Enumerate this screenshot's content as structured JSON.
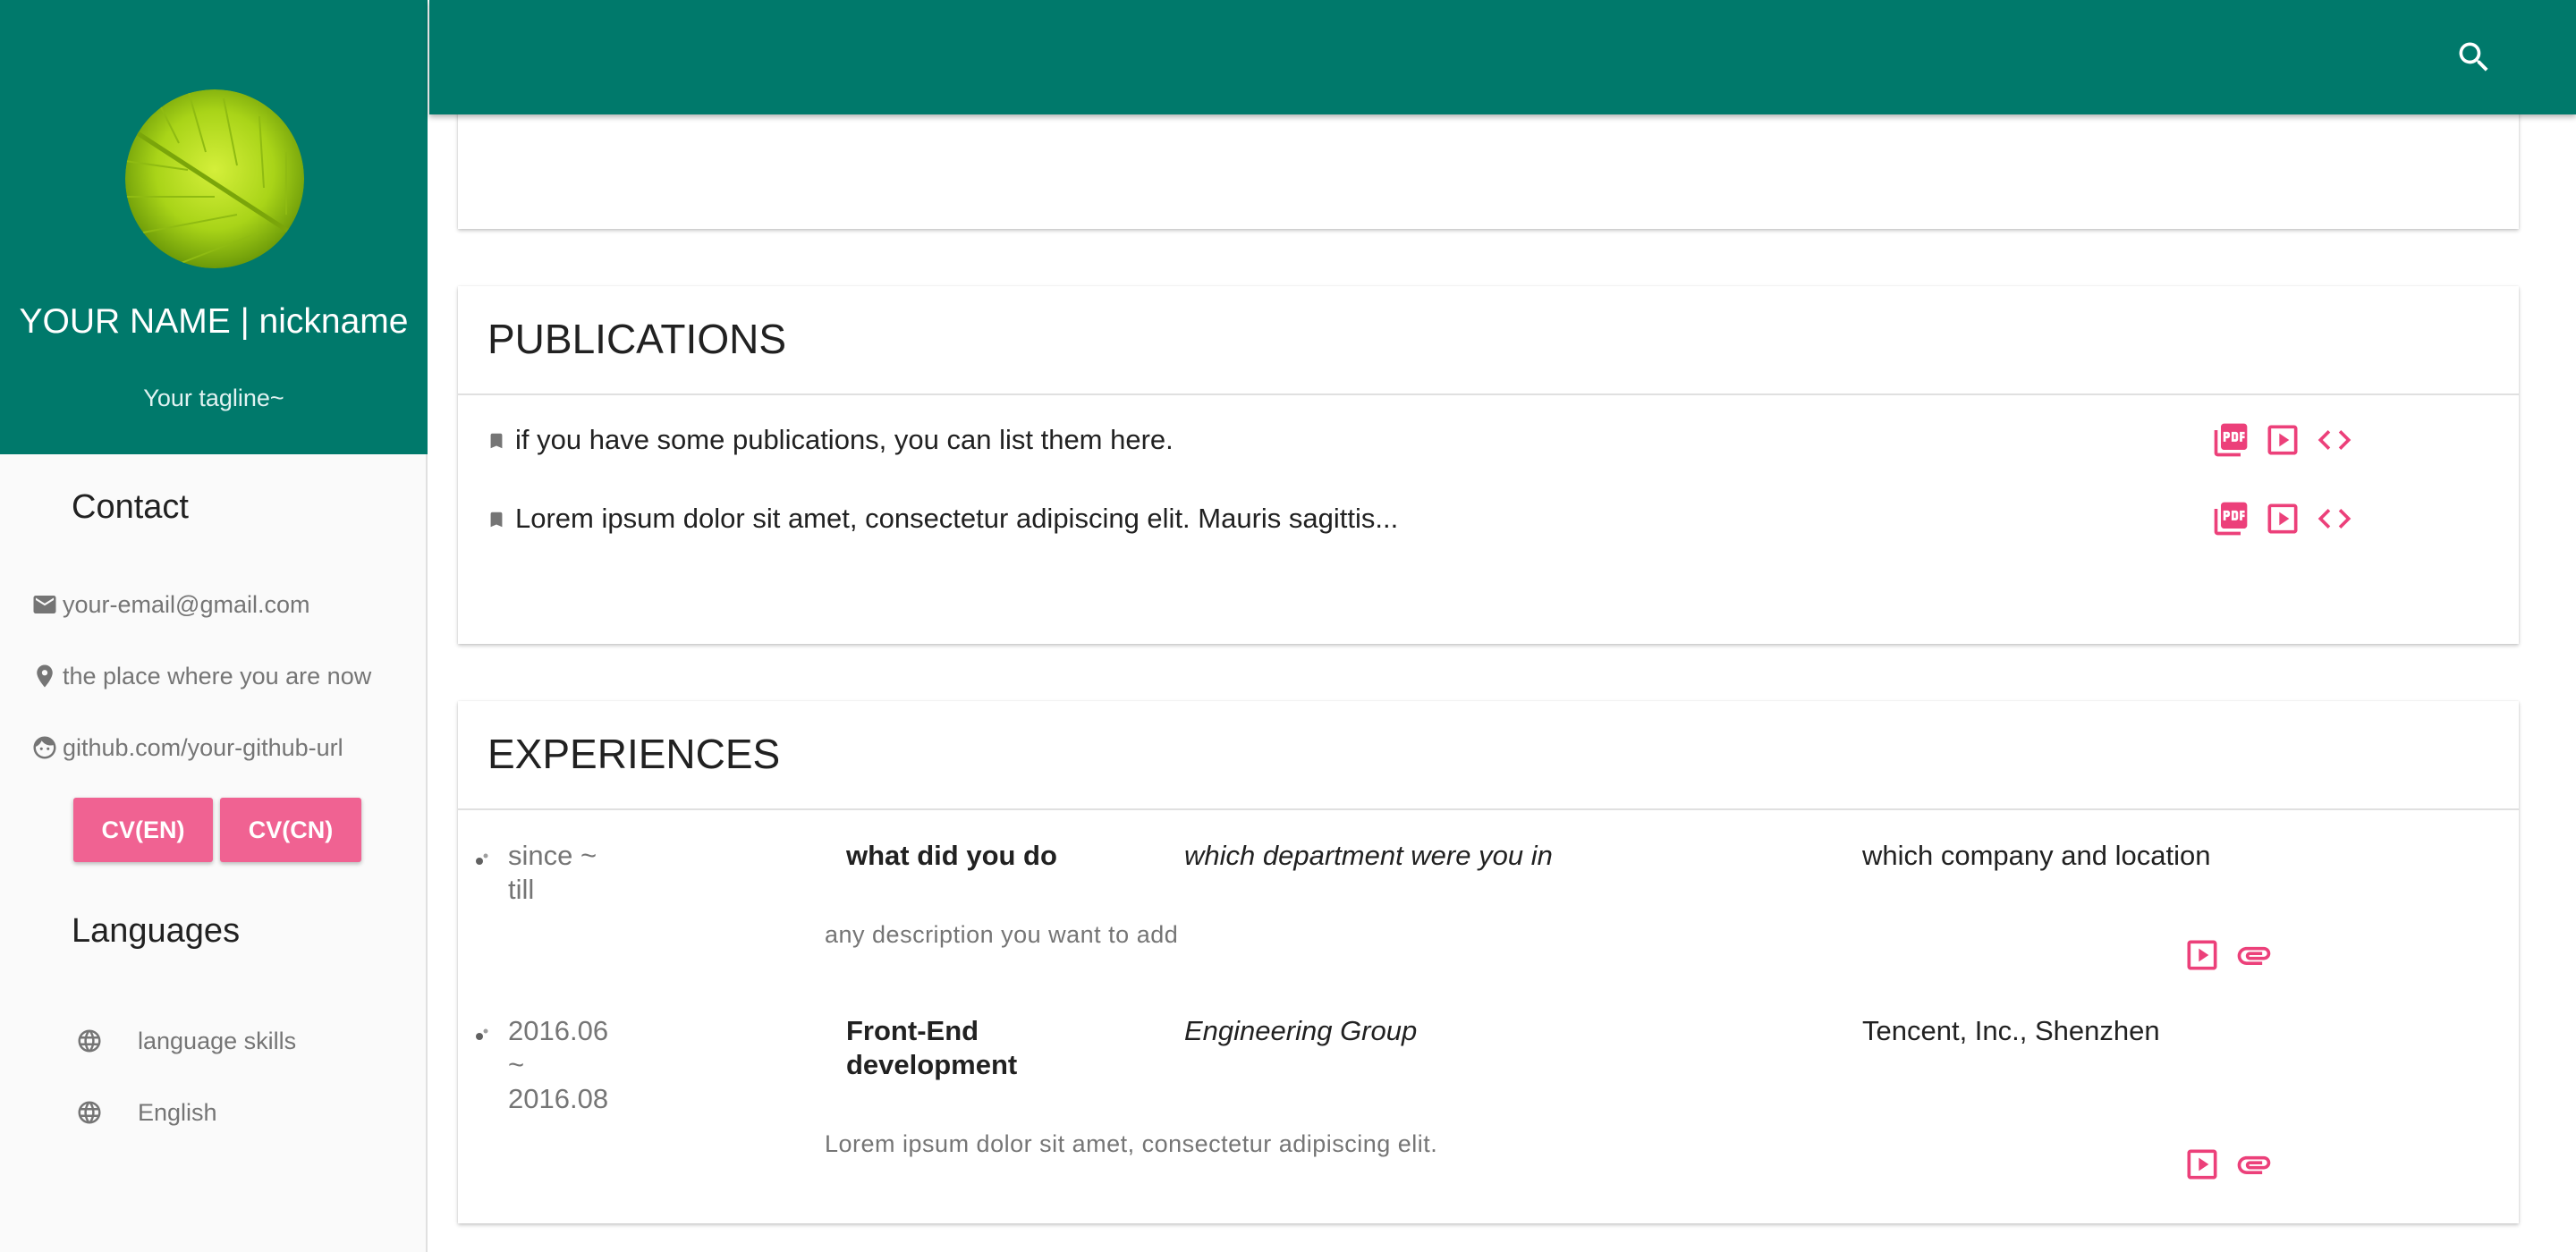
{
  "profile": {
    "name": "YOUR NAME | nickname",
    "tagline": "Your tagline~"
  },
  "contact": {
    "title": "Contact",
    "email": "your-email@gmail.com",
    "location": "the place where you are now",
    "github": "github.com/your-github-url",
    "cv_en": "CV(EN)",
    "cv_cn": "CV(CN)"
  },
  "languages": {
    "title": "Languages",
    "items": [
      "language skills",
      "English"
    ]
  },
  "publications": {
    "title": "PUBLICATIONS",
    "items": [
      {
        "text": "if you have some publications, you can list them here.",
        "icons": [
          "pdf-icon",
          "video-icon",
          "code-icon"
        ]
      },
      {
        "text": "Lorem ipsum dolor sit amet, consectetur adipiscing elit. Mauris sagittis...",
        "icons": [
          "pdf-icon",
          "video-icon",
          "code-icon"
        ]
      }
    ]
  },
  "experiences": {
    "title": "EXPERIENCES",
    "items": [
      {
        "date_line1": "since ~",
        "date_line2": "till",
        "date_line3": "",
        "role_line1": "what did you do",
        "role_line2": "",
        "department": "which department were you in",
        "company": "which company and location",
        "description": "any description you want to add"
      },
      {
        "date_line1": "2016.06",
        "date_line2": "~",
        "date_line3": "2016.08",
        "role_line1": "Front-End",
        "role_line2": "development",
        "department": "Engineering Group",
        "company": "Tencent, Inc., Shenzhen",
        "description": "Lorem ipsum dolor sit amet, consectetur adipiscing elit."
      }
    ]
  },
  "colors": {
    "primary": "#00796b",
    "accent": "#f06292",
    "icon_accent": "#ec407a",
    "text_secondary": "#757575"
  }
}
